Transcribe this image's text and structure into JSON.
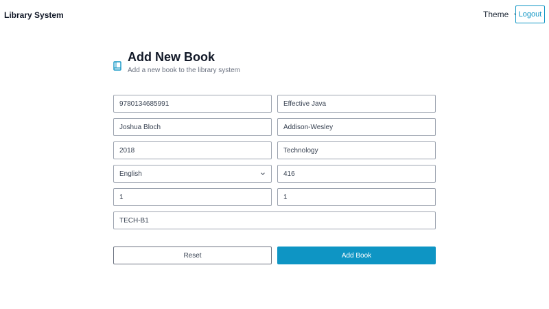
{
  "app": {
    "title": "Library System"
  },
  "nav": {
    "theme_label": "Theme",
    "logout_label": "Logout"
  },
  "page": {
    "title": "Add New Book",
    "subtitle": "Add a new book to the library system",
    "icon": "book-icon"
  },
  "form": {
    "isbn": "9780134685991",
    "book_title": "Effective Java",
    "author": "Joshua Bloch",
    "publisher": "Addison-Wesley",
    "year": "2018",
    "category": "Technology",
    "language": "English",
    "pages": "416",
    "total_copies": "1",
    "available_copies": "1",
    "location": "TECH-B1"
  },
  "actions": {
    "reset_label": "Reset",
    "submit_label": "Add Book"
  },
  "colors": {
    "accent": "#0e95c4",
    "border": "#9ca3af"
  }
}
